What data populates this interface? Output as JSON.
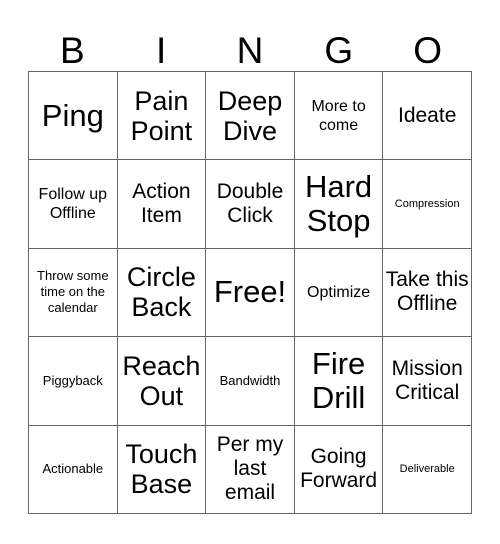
{
  "header": {
    "letters": [
      {
        "label": "B"
      },
      {
        "label": "I"
      },
      {
        "label": "N"
      },
      {
        "label": "G"
      },
      {
        "label": "O"
      }
    ]
  },
  "grid": {
    "rows": 5,
    "columns": 5,
    "free_space_label": "Free!",
    "free_space_position": "row3-col3",
    "cells": [
      {
        "label": "Ping",
        "size": "fs-xl",
        "row": 1,
        "col": 1
      },
      {
        "label": "Pain Point",
        "size": "fs-lg",
        "row": 1,
        "col": 2
      },
      {
        "label": "Deep Dive",
        "size": "fs-lg",
        "row": 1,
        "col": 3
      },
      {
        "label": "More to come",
        "size": "fs-sm",
        "row": 1,
        "col": 4
      },
      {
        "label": "Ideate",
        "size": "fs-md",
        "row": 1,
        "col": 5
      },
      {
        "label": "Follow up Offline",
        "size": "fs-sm",
        "row": 2,
        "col": 1
      },
      {
        "label": "Action Item",
        "size": "fs-md",
        "row": 2,
        "col": 2
      },
      {
        "label": "Double Click",
        "size": "fs-md",
        "row": 2,
        "col": 3
      },
      {
        "label": "Hard Stop",
        "size": "fs-xl",
        "row": 2,
        "col": 4
      },
      {
        "label": "Compression",
        "size": "fs-xxs",
        "row": 2,
        "col": 5
      },
      {
        "label": "Throw some time on the calendar",
        "size": "fs-xs",
        "row": 3,
        "col": 1
      },
      {
        "label": "Circle Back",
        "size": "fs-lg",
        "row": 3,
        "col": 2
      },
      {
        "label": "Free!",
        "size": "fs-xl",
        "row": 3,
        "col": 3
      },
      {
        "label": "Optimize",
        "size": "fs-sm",
        "row": 3,
        "col": 4
      },
      {
        "label": "Take this Offline",
        "size": "fs-md",
        "row": 3,
        "col": 5
      },
      {
        "label": "Piggyback",
        "size": "fs-xs",
        "row": 4,
        "col": 1
      },
      {
        "label": "Reach Out",
        "size": "fs-lg",
        "row": 4,
        "col": 2
      },
      {
        "label": "Bandwidth",
        "size": "fs-xs",
        "row": 4,
        "col": 3
      },
      {
        "label": "Fire Drill",
        "size": "fs-xl",
        "row": 4,
        "col": 4
      },
      {
        "label": "Mission Critical",
        "size": "fs-md",
        "row": 4,
        "col": 5
      },
      {
        "label": "Actionable",
        "size": "fs-xs",
        "row": 5,
        "col": 1
      },
      {
        "label": "Touch Base",
        "size": "fs-lg",
        "row": 5,
        "col": 2
      },
      {
        "label": "Per my last email",
        "size": "fs-md",
        "row": 5,
        "col": 3
      },
      {
        "label": "Going Forward",
        "size": "fs-md",
        "row": 5,
        "col": 4
      },
      {
        "label": "Deliverable",
        "size": "fs-xxs",
        "row": 5,
        "col": 5
      }
    ]
  },
  "colors": {
    "background": "#ffffff",
    "text": "#000000",
    "grid_line": "#666666"
  }
}
